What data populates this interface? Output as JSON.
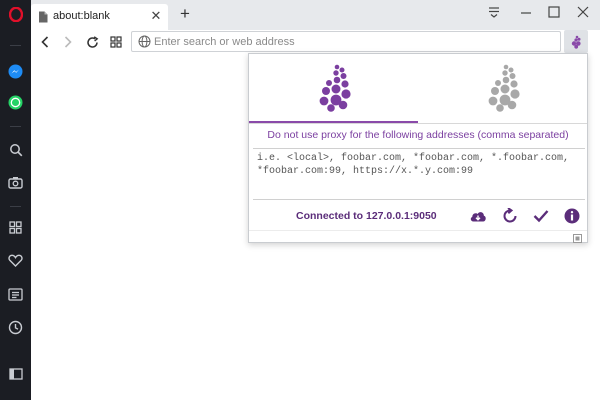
{
  "browser": {
    "tab": {
      "title": "about:blank",
      "icon": "page-icon"
    },
    "address": {
      "placeholder": "Enter search or web address",
      "value": ""
    },
    "sidebar_icons": [
      "opera-logo-icon",
      "messenger-icon",
      "whatsapp-icon",
      "search-icon",
      "camera-icon",
      "speed-dial-icon",
      "heart-icon",
      "news-icon",
      "history-icon",
      "sidebar-toggle-icon"
    ]
  },
  "popup": {
    "modes": [
      {
        "name": "proxy-enabled",
        "active": true,
        "color": "#7b3fa0"
      },
      {
        "name": "proxy-disabled",
        "active": false,
        "color": "#a8a8a8"
      }
    ],
    "note": "Do not use proxy for the following addresses (comma separated)",
    "bypass_placeholder": "i.e. <local>, foobar.com, *foobar.com, *.foobar.com, *foobar.com:99, https://x.*.y.com:99",
    "status": "Connected to 127.0.0.1:9050",
    "actions": [
      "download-icon",
      "reload-icon",
      "check-icon",
      "info-icon"
    ]
  },
  "colors": {
    "accent": "#7b3fa0",
    "sidebar": "#1b1d23",
    "opera_red": "#e0102a"
  }
}
